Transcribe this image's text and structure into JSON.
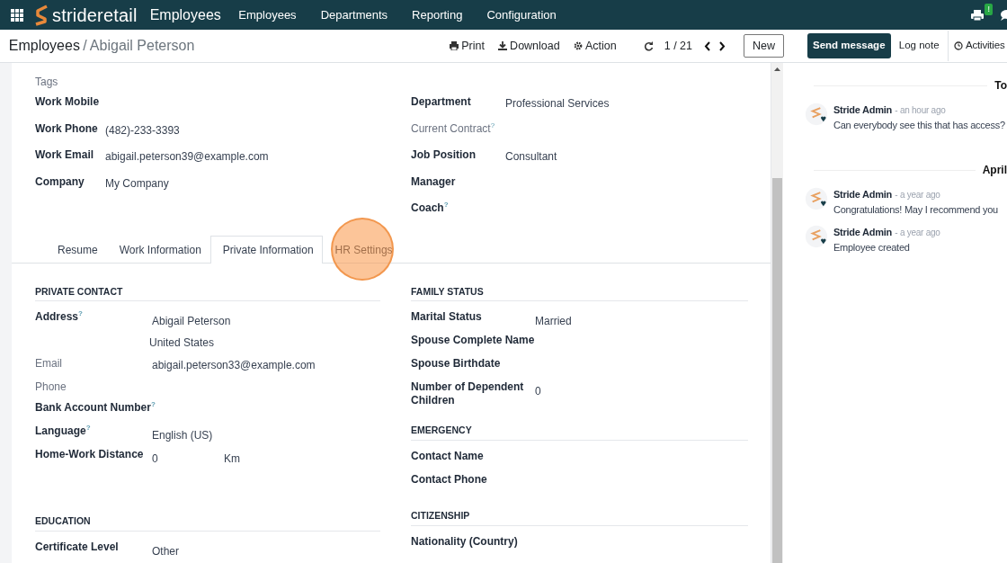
{
  "topbar": {
    "brand": "strideretail",
    "app": "Employees",
    "menus": [
      "Employees",
      "Departments",
      "Reporting",
      "Configuration"
    ],
    "systray_badge": "!"
  },
  "breadcrumb": [
    "Employees",
    "Abigail Peterson"
  ],
  "breadcrumb_separator": "/",
  "actions": [
    "Print",
    "Download",
    "Action"
  ],
  "pager": "1 / 21",
  "new_button": "New",
  "header_fields": {
    "left": [
      {
        "label": "Tags",
        "muted": true
      },
      {
        "label": "Work Mobile",
        "muted": false
      },
      {
        "label": "Work Phone",
        "value": "(482)-233-3393",
        "muted": false
      },
      {
        "label": "Work Email",
        "value": "abigail.peterson39@example.com",
        "muted": false
      },
      {
        "label": "Company",
        "value": "My Company",
        "muted": false
      }
    ],
    "right": [
      {
        "label": "Department",
        "value": "Professional Services",
        "muted": false
      },
      {
        "label": "Current Contract$^{?}$",
        "muted": true
      },
      {
        "label": "Job Position",
        "value": "Consultant",
        "muted": false
      },
      {
        "label": "Manager",
        "muted": false
      },
      {
        "label": "Coach$^{?}$",
        "muted": false
      }
    ]
  },
  "tabs": [
    {
      "label": "Resume",
      "selected": false,
      "highlighted": false
    },
    {
      "label": "Work Information",
      "selected": false,
      "highlighted": false
    },
    {
      "label": "Private Information",
      "selected": true,
      "highlighted": false
    },
    {
      "label": "HR Settings",
      "selected": false,
      "highlighted": true
    }
  ],
  "sections": {
    "left": [
      {
        "title": "PRIVATE CONTACT",
        "fields": [
          {
            "label": "Address$^{?}$",
            "lines": [
              "Abigail Peterson",
              "United States"
            ],
            "muted": false
          },
          {
            "label": "Email",
            "lines": [
              "abigail.peterson33@example.com"
            ],
            "muted": true
          },
          {
            "label": "Phone",
            "muted": true
          },
          {
            "label": "Bank Account Number$^{?}$",
            "muted": false
          },
          {
            "label": "Language$^{?}$",
            "lines": [
              "English (US)"
            ],
            "muted": false
          },
          {
            "label": "Home-Work Distance",
            "lines": [
              "0"
            ],
            "unit": "Km",
            "muted": false
          }
        ]
      },
      {
        "title": "EDUCATION",
        "fields": [
          {
            "label": "Certificate Level",
            "lines": [
              "Other"
            ],
            "muted": false
          }
        ]
      }
    ],
    "right": [
      {
        "title": "FAMILY STATUS",
        "fields": [
          {
            "label": "Marital Status",
            "lines": [
              "Married"
            ],
            "muted": false
          },
          {
            "label": "Spouse Complete Name",
            "muted": false
          },
          {
            "label": "Spouse Birthdate",
            "muted": false
          },
          {
            "label": "Number of Dependent Children",
            "lines": [
              "0"
            ],
            "muted": false
          }
        ]
      },
      {
        "title": "EMERGENCY",
        "fields": [
          {
            "label": "Contact Name",
            "muted": false
          },
          {
            "label": "Contact Phone",
            "muted": false
          }
        ]
      },
      {
        "title": "CITIZENSHIP",
        "fields": [
          {
            "label": "Nationality (Country)",
            "muted": false
          }
        ]
      }
    ]
  },
  "chatter": {
    "buttons": [
      {
        "label": "Send message",
        "kind": "primary"
      },
      {
        "label": "Log note",
        "kind": "plain"
      },
      {
        "label": "Activities",
        "kind": "activities"
      }
    ],
    "groups": [
      {
        "date": "To",
        "messages": [
          {
            "author": "Stride Admin",
            "time": "- an hour ago",
            "body": "Can everybody see this that has access?"
          }
        ]
      },
      {
        "date": "April",
        "messages": [
          {
            "author": "Stride Admin",
            "time": "- a year ago",
            "body": "Congratulations! May I recommend you"
          },
          {
            "author": "Stride Admin",
            "time": "- a year ago",
            "body": "Employee created"
          }
        ]
      }
    ]
  }
}
